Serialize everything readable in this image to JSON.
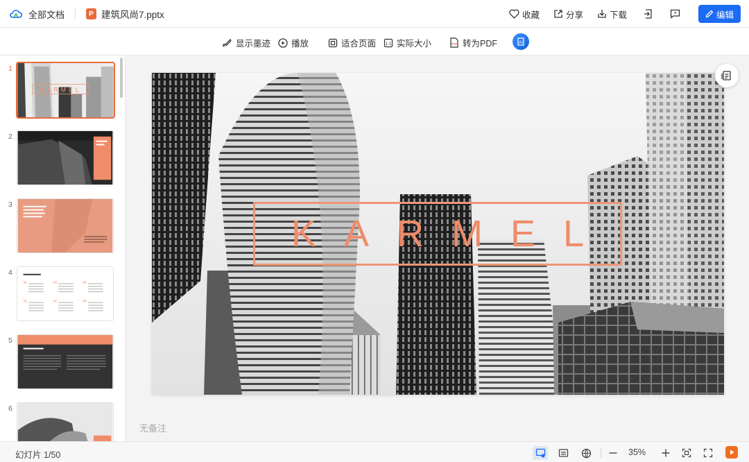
{
  "header": {
    "all_docs": "全部文档",
    "file_name": "建筑风尚7.pptx",
    "ppt_badge": "P",
    "favorite": "收藏",
    "share": "分享",
    "download": "下载",
    "edit": "编辑"
  },
  "toolbar": {
    "show_ink": "显示墨迹",
    "play": "播放",
    "fit_page": "适合页面",
    "actual_size": "实际大小",
    "to_pdf": "转为PDF"
  },
  "thumbnails": [
    {
      "num": "1",
      "active": true
    },
    {
      "num": "2",
      "active": false
    },
    {
      "num": "3",
      "active": false
    },
    {
      "num": "4",
      "active": false
    },
    {
      "num": "5",
      "active": false
    },
    {
      "num": "6",
      "active": false
    }
  ],
  "slide": {
    "title": "KARMEL",
    "accent_color": "#ef8c6a"
  },
  "notes": "无备注",
  "status": {
    "slide_count": "幻灯片 1/50",
    "zoom": "35%"
  },
  "colors": {
    "primary": "#1b6bf3",
    "accent": "#e96b3a"
  }
}
